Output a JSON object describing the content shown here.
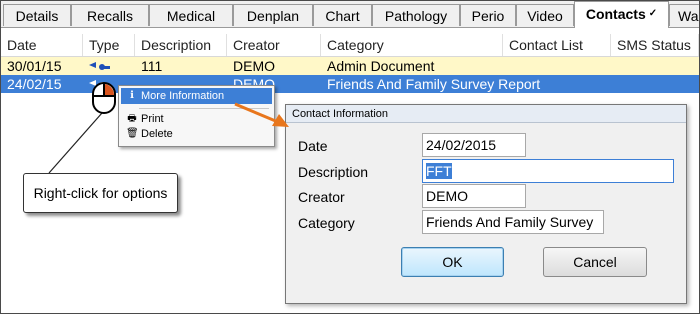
{
  "tabs": [
    {
      "label": "Details"
    },
    {
      "label": "Recalls"
    },
    {
      "label": "Medical"
    },
    {
      "label": "Denplan"
    },
    {
      "label": "Chart"
    },
    {
      "label": "Pathology"
    },
    {
      "label": "Perio"
    },
    {
      "label": "Video"
    },
    {
      "label": "Contacts",
      "active": true
    },
    {
      "label": "Wa"
    }
  ],
  "table": {
    "columns": [
      "Date",
      "Type",
      "Description",
      "Creator",
      "Category",
      "Contact List",
      "SMS Status"
    ],
    "rows": [
      {
        "date": "30/01/15",
        "type_icon": "contact-type-icon",
        "description": "111",
        "creator": "DEMO",
        "category": "Admin Document",
        "contact_list": "",
        "sms_status": ""
      },
      {
        "date": "24/02/15",
        "type_icon": "contact-type-icon",
        "description": "",
        "creator": "DEMO",
        "category": "Friends And Family Survey Report",
        "contact_list": "",
        "sms_status": "",
        "selected": true
      }
    ]
  },
  "context_menu": {
    "items": [
      {
        "icon": "info-icon",
        "label": "More Information",
        "highlighted": true
      },
      {
        "icon": "print-icon",
        "label": "Print"
      },
      {
        "icon": "delete-icon",
        "label": "Delete"
      }
    ]
  },
  "callout": {
    "text": "Right-click for options"
  },
  "dialog": {
    "title": "Contact Information",
    "fields": {
      "date": {
        "label": "Date",
        "value": "24/02/2015"
      },
      "description": {
        "label": "Description",
        "value": "FFT"
      },
      "creator": {
        "label": "Creator",
        "value": "DEMO"
      },
      "category": {
        "label": "Category",
        "value": "Friends And Family Survey"
      }
    },
    "ok_label": "OK",
    "cancel_label": "Cancel"
  },
  "colors": {
    "selection": "#3d7fd6",
    "highlight_row": "#fff8c8",
    "annotation_arrow": "#e8761c"
  }
}
